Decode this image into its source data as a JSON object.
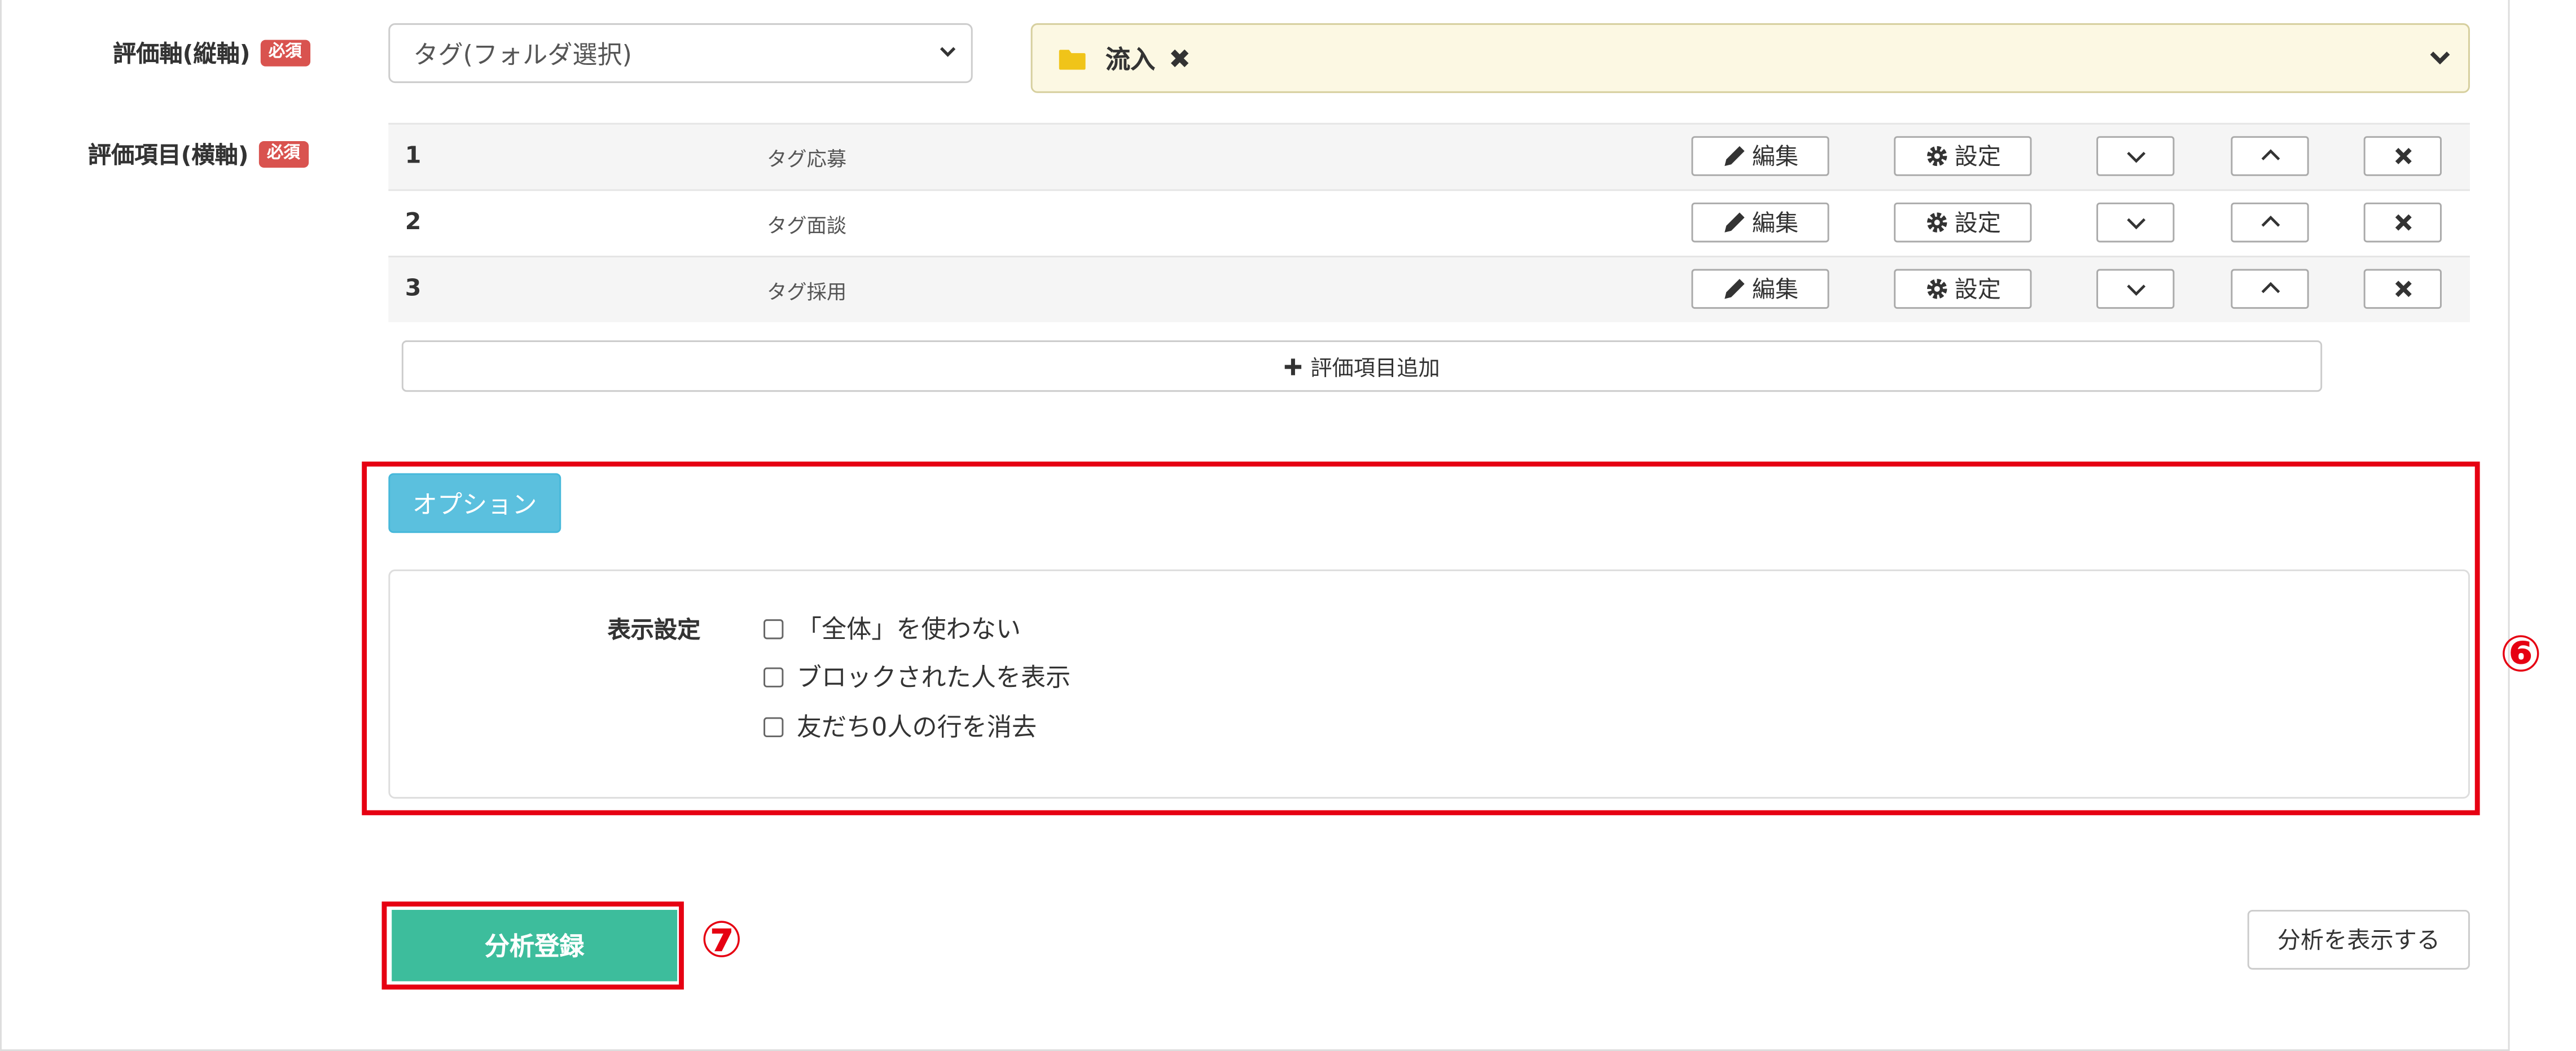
{
  "axes": {
    "vertical_label": "評価軸(縦軸)",
    "horizontal_label": "評価項目(横軸)",
    "required_badge": "必須",
    "select_value": "タグ(フォルダ選択)",
    "selected_tag": "流入"
  },
  "items": [
    {
      "num": "1",
      "name": "タグ応募"
    },
    {
      "num": "2",
      "name": "タグ面談"
    },
    {
      "num": "3",
      "name": "タグ採用"
    }
  ],
  "row_buttons": {
    "edit": "編集",
    "settings": "設定"
  },
  "add_item_label": "評価項目追加",
  "options": {
    "toggle_label": "オプション",
    "display_setting_label": "表示設定",
    "checkboxes": [
      {
        "label": "「全体」を使わない",
        "checked": false
      },
      {
        "label": "ブロックされた人を表示",
        "checked": false
      },
      {
        "label": "友だち0人の行を消去",
        "checked": false
      }
    ]
  },
  "annotations": {
    "six": "⑥",
    "seven": "⑦",
    "highlight_color": "#e60012"
  },
  "actions": {
    "submit_label": "分析登録",
    "view_label": "分析を表示する"
  },
  "colors": {
    "required": "#d9534f",
    "option_button": "#5bc0de",
    "submit": "#3dbd9c",
    "tag_box_bg": "#fcf8e3"
  }
}
